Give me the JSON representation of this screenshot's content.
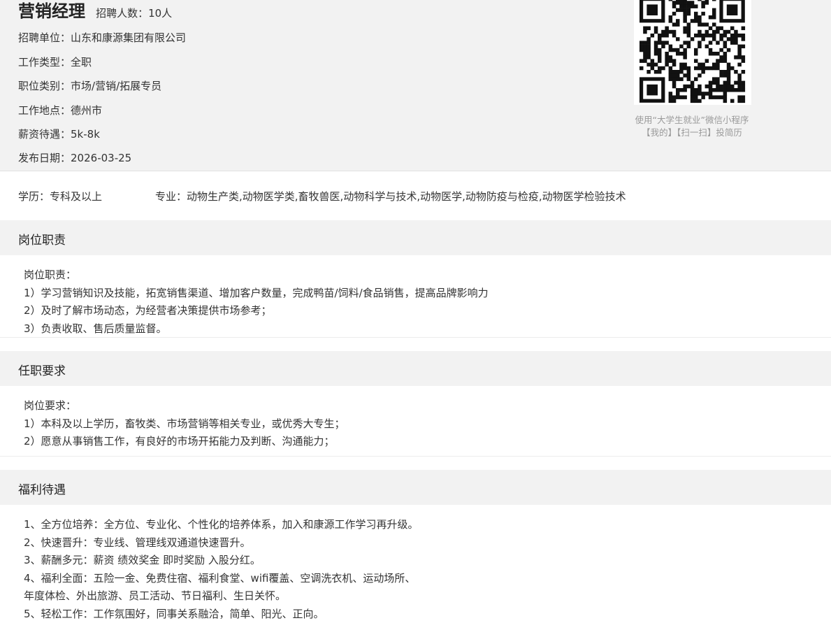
{
  "job": {
    "title": "营销经理",
    "hire_count": "招聘人数：10人"
  },
  "info": [
    {
      "label": "招聘单位：",
      "value": "山东和康源集团有限公司"
    },
    {
      "label": "工作类型：",
      "value": "全职"
    },
    {
      "label": "职位类别：",
      "value": "市场/营销/拓展专员"
    },
    {
      "label": "工作地点：",
      "value": "德州市"
    },
    {
      "label": "薪资待遇：",
      "value": "5k-8k"
    },
    {
      "label": "发布日期：",
      "value": "2026-03-25"
    }
  ],
  "qr": {
    "caption_line1": "使用“大学生就业”微信小程序",
    "caption_line2": "【我的】【扫一扫】投简历"
  },
  "requirements": {
    "education_label": "学历：",
    "education_value": "专科及以上",
    "major_label": "专业：",
    "major_value": "动物生产类,动物医学类,畜牧兽医,动物科学与技术,动物医学,动物防疫与检疫,动物医学检验技术"
  },
  "sections": {
    "duties": {
      "title": "岗位职责",
      "lines": [
        "岗位职责：",
        "1）学习营销知识及技能，拓宽销售渠道、增加客户数量，完成鸭苗/饲料/食品销售，提高品牌影响力",
        "2）及时了解市场动态，为经营者决策提供市场参考；",
        "3）负责收取、售后质量监督。"
      ]
    },
    "qualifications": {
      "title": "任职要求",
      "lines": [
        "岗位要求：",
        "1）本科及以上学历，畜牧类、市场营销等相关专业，或优秀大专生；",
        "2）愿意从事销售工作，有良好的市场开拓能力及判断、沟通能力；"
      ]
    },
    "benefits": {
      "title": "福利待遇",
      "lines": [
        "1、全方位培养：全方位、专业化、个性化的培养体系，加入和康源工作学习再升级。",
        "2、快速晋升：专业线、管理线双通道快速晋升。",
        "3、薪酬多元：薪资 绩效奖金 即时奖励 入股分红。",
        "4、福利全面：五险一金、免费住宿、福利食堂、wifi覆盖、空调洗衣机、运动场所、",
        "年度体检、外出旅游、员工活动、节日福利、生日关怀。",
        "5、轻松工作：工作氛围好，同事关系融洽，简单、阳光、正向。"
      ]
    }
  }
}
